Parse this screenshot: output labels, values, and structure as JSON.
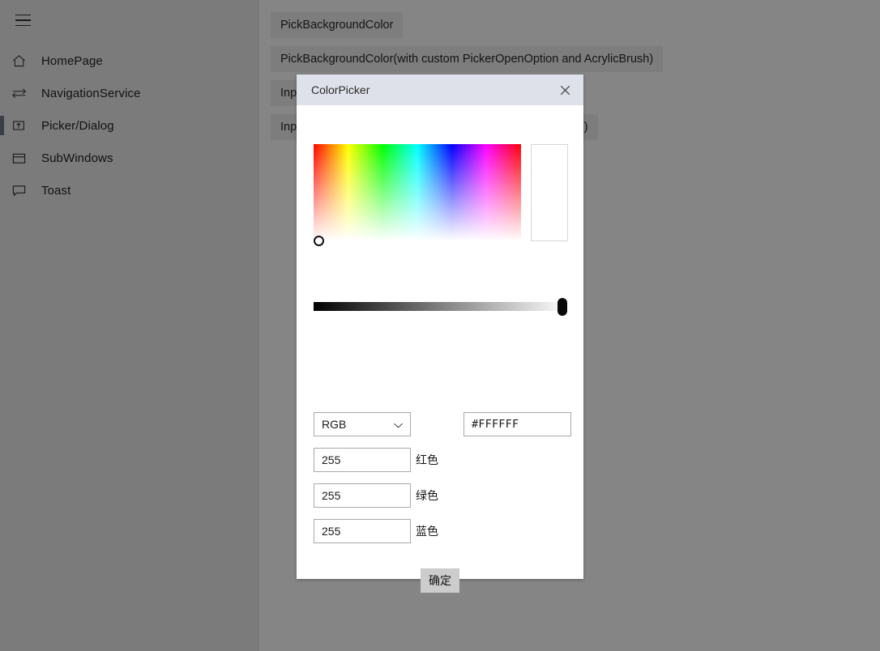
{
  "sidebar": {
    "menu_toggle_name": "hamburger-menu",
    "items": [
      {
        "label": "HomePage",
        "icon": "home-icon",
        "selected": false
      },
      {
        "label": "NavigationService",
        "icon": "transfer-arrows-icon",
        "selected": false
      },
      {
        "label": "Picker/Dialog",
        "icon": "open-in-box-icon",
        "selected": true
      },
      {
        "label": "SubWindows",
        "icon": "window-icon",
        "selected": false
      },
      {
        "label": "Toast",
        "icon": "speech-bubble-icon",
        "selected": false
      }
    ]
  },
  "main": {
    "buttons": [
      {
        "label": "PickBackgroundColor"
      },
      {
        "label": "PickBackgroundColor(with custom PickerOpenOption and AcrylicBrush)"
      },
      {
        "label": "InputText"
      },
      {
        "label": "InputText(with custom PickerOpenOption and AcrylicBrush)"
      }
    ]
  },
  "dialog": {
    "title": "ColorPicker",
    "close_icon": "close-icon",
    "preview_color": "#FFFFFF",
    "mode": {
      "selected": "RGB",
      "options": [
        "RGB"
      ],
      "chevron_icon": "chevron-down-icon"
    },
    "hex": {
      "value": "#FFFFFF",
      "placeholder": "#FFFFFF"
    },
    "channels": [
      {
        "label": "红色",
        "value": "255"
      },
      {
        "label": "绿色",
        "value": "255"
      },
      {
        "label": "蓝色",
        "value": "255"
      }
    ],
    "confirm_label": "确定",
    "value_slider": {
      "percent": 100
    },
    "sv_picker": {
      "hue": 0,
      "saturation": 0,
      "value": 100
    }
  },
  "colors": {
    "sidebar_bg": "#7B7B7B",
    "content_bg": "#858585",
    "button_bg": "#7D7D7D",
    "dialog_bg": "#FFFFFF",
    "titlebar_bg": "#DFE1EA",
    "selection_indicator": "#3A3E45",
    "confirm_bg": "#CCCCCC"
  }
}
